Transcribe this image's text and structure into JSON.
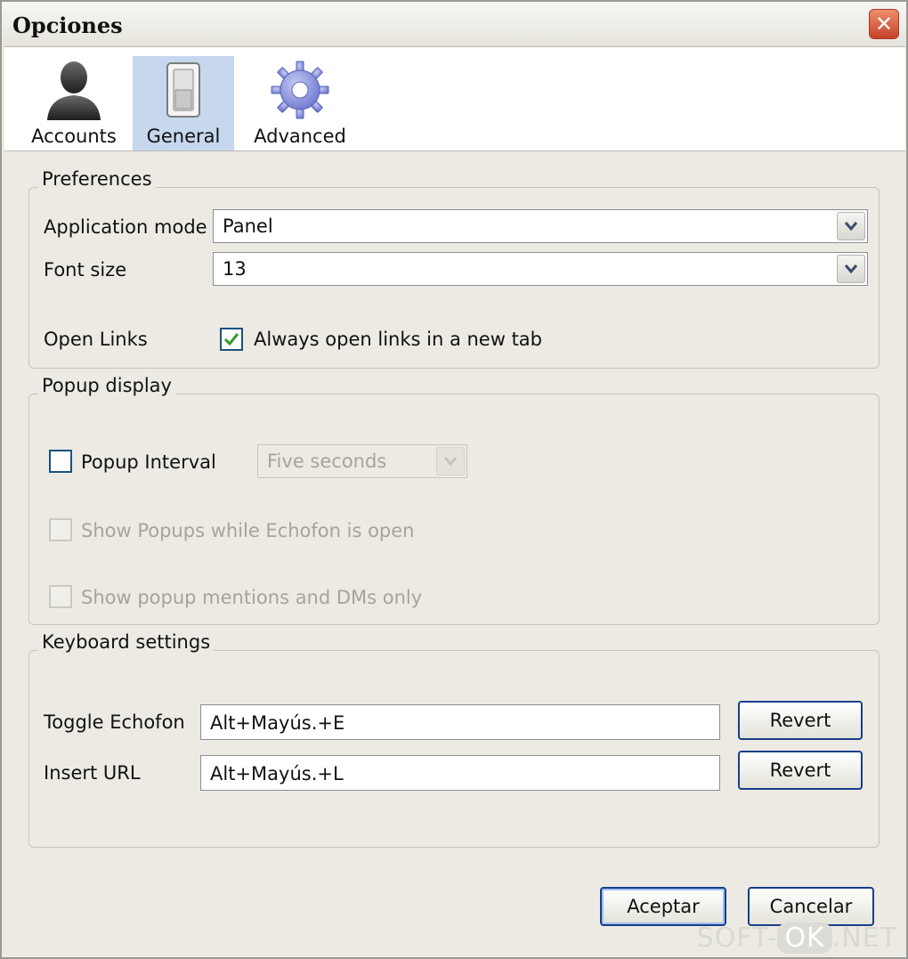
{
  "window": {
    "title": "Opciones",
    "close_glyph": "✕"
  },
  "toolbar": {
    "tabs": [
      {
        "label": "Accounts",
        "icon": "user-silhouette-icon",
        "selected": false
      },
      {
        "label": "General",
        "icon": "toggle-switch-icon",
        "selected": true
      },
      {
        "label": "Advanced",
        "icon": "gear-icon",
        "selected": false
      }
    ]
  },
  "preferences": {
    "legend": "Preferences",
    "application_mode": {
      "label": "Application mode",
      "value": "Panel"
    },
    "font_size": {
      "label": "Font size",
      "value": "13"
    },
    "open_links": {
      "label": "Open Links",
      "checkbox_label": "Always open links in a new tab",
      "checked": true
    }
  },
  "popup_display": {
    "legend": "Popup display",
    "popup_interval": {
      "label": "Popup Interval",
      "checked": false,
      "value": "Five seconds",
      "enabled": false
    },
    "show_popups": {
      "label": "Show Popups while Echofon is open",
      "checked": false,
      "enabled": false
    },
    "mentions_only": {
      "label": "Show popup mentions and DMs only",
      "checked": false,
      "enabled": false
    }
  },
  "keyboard": {
    "legend": "Keyboard settings",
    "toggle": {
      "label": "Toggle Echofon",
      "value": "Alt+Mayús.+E",
      "button": "Revert"
    },
    "insert_url": {
      "label": "Insert URL",
      "value": "Alt+Mayús.+L",
      "button": "Revert"
    }
  },
  "footer": {
    "accept": "Aceptar",
    "cancel": "Cancelar"
  },
  "watermark": {
    "left": "SOFT-",
    "mid": "OK",
    "right": ".NET"
  },
  "colors": {
    "dialog_bg": "#eceae3",
    "selected_tab": "#c6d7ee",
    "button_border": "#1a3d8a",
    "check_green": "#2f9e2f"
  }
}
